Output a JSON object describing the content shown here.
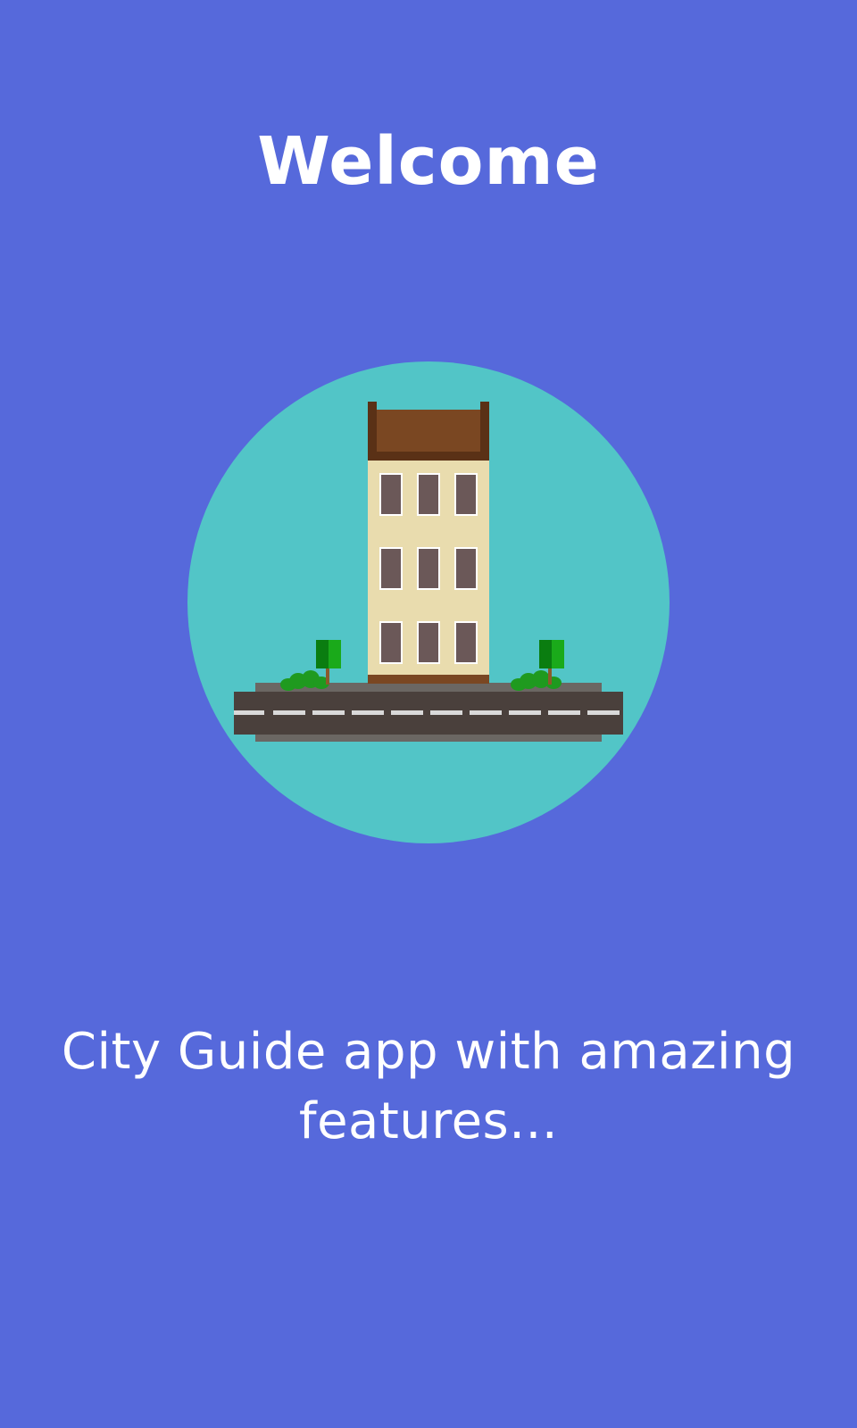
{
  "screen": {
    "background_color": "#5669db",
    "title": "Welcome",
    "subtitle": "City Guide app with amazing features..."
  },
  "illustration": {
    "icon": "city-building-icon",
    "circle_color": "#52c5c7"
  }
}
